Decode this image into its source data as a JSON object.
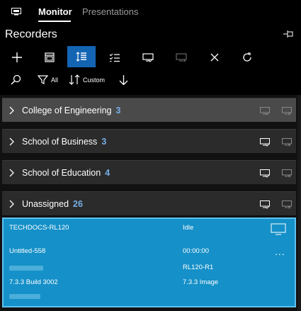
{
  "tabs": {
    "monitor": "Monitor",
    "presentations": "Presentations"
  },
  "section_title": "Recorders",
  "toolbar": {
    "filter_label": "All",
    "sort_label": "Custom"
  },
  "groups": [
    {
      "name": "College of Engineering",
      "count": "3"
    },
    {
      "name": "School of Business",
      "count": "3"
    },
    {
      "name": "School of Education",
      "count": "4"
    },
    {
      "name": "Unassigned",
      "count": "26"
    }
  ],
  "recorder": {
    "name": "TECHDOCS-RL120",
    "status": "Idle",
    "session": "Untitled-558",
    "duration": "00:00:00",
    "model": "RL120-R1",
    "firmware": "7.3.3 Build 3002",
    "image": "7.3.3 Image"
  },
  "colors": {
    "accent": "#1464b4",
    "card": "#1590c8",
    "count": "#76aee6"
  }
}
